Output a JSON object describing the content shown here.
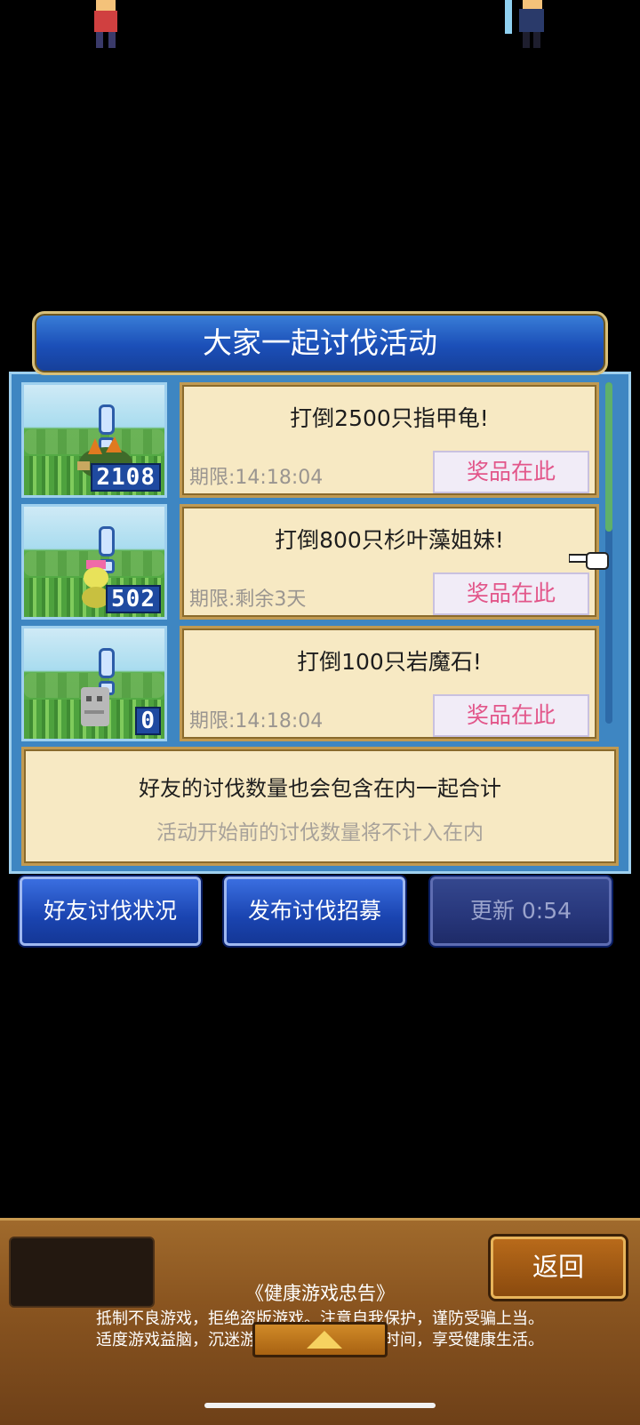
{
  "dialog": {
    "title": "大家一起讨伐活动",
    "quests": [
      {
        "task": "打倒2500只指甲龟!",
        "deadline": "期限:14:18:04",
        "prize_label": "奖品在此",
        "count": "2108",
        "monster_icon": "turtle-monster-icon"
      },
      {
        "task": "打倒800只杉叶藻姐妹!",
        "deadline": "期限:剩余3天",
        "prize_label": "奖品在此",
        "count": "502",
        "monster_icon": "snake-girl-monster-icon"
      },
      {
        "task": "打倒100只岩魔石!",
        "deadline": "期限:14:18:04",
        "prize_label": "奖品在此",
        "count": "0",
        "monster_icon": "rock-golem-monster-icon"
      }
    ],
    "info": {
      "line1": "好友的讨伐数量也会包含在内一起合计",
      "line2": "活动开始前的讨伐数量将不计入在内"
    },
    "buttons": {
      "friend_status": "好友讨伐状况",
      "post_recruit": "发布讨伐招募",
      "refresh": "更新 0:54"
    }
  },
  "bottom_bar": {
    "back_label": "返回",
    "notice_title": "《健康游戏忠告》",
    "notice_line1": "抵制不良游戏，拒绝盗版游戏。注意自我保护，谨防受骗上当。",
    "notice_line2": "适度游戏益脑，沉迷游戏伤身。合理安排时间，享受健康生活。"
  },
  "colors": {
    "prize_text": "#e2568a",
    "button_blue": "#1a44b0",
    "card_bg": "#f7e9c3"
  }
}
